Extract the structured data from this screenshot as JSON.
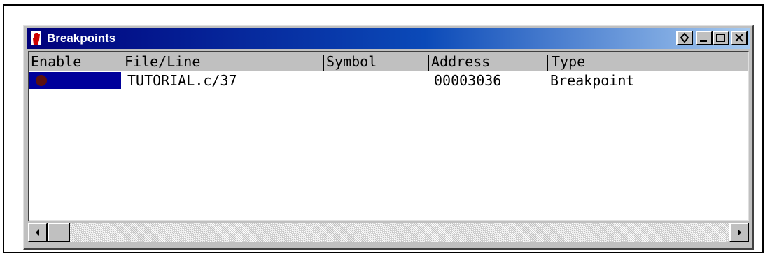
{
  "window": {
    "title": "Breakpoints",
    "icon": "hand-stop-icon",
    "title_buttons": [
      "restore-icon",
      "minimize-icon",
      "maximize-icon",
      "close-icon"
    ]
  },
  "breakpoints": {
    "columns": [
      "Enable",
      "File/Line",
      "Symbol",
      "Address",
      "Type"
    ],
    "rows": [
      {
        "enabled": true,
        "file_line": "TUTORIAL.c/37",
        "symbol": "",
        "address": "00003036",
        "type": "Breakpoint"
      }
    ]
  },
  "colors": {
    "titlebar_start": "#00007b",
    "titlebar_end": "#a6caf0",
    "selection": "#00009a",
    "breakpoint_dot": "#5a1010"
  },
  "scrollbar": {
    "orientation": "horizontal"
  }
}
